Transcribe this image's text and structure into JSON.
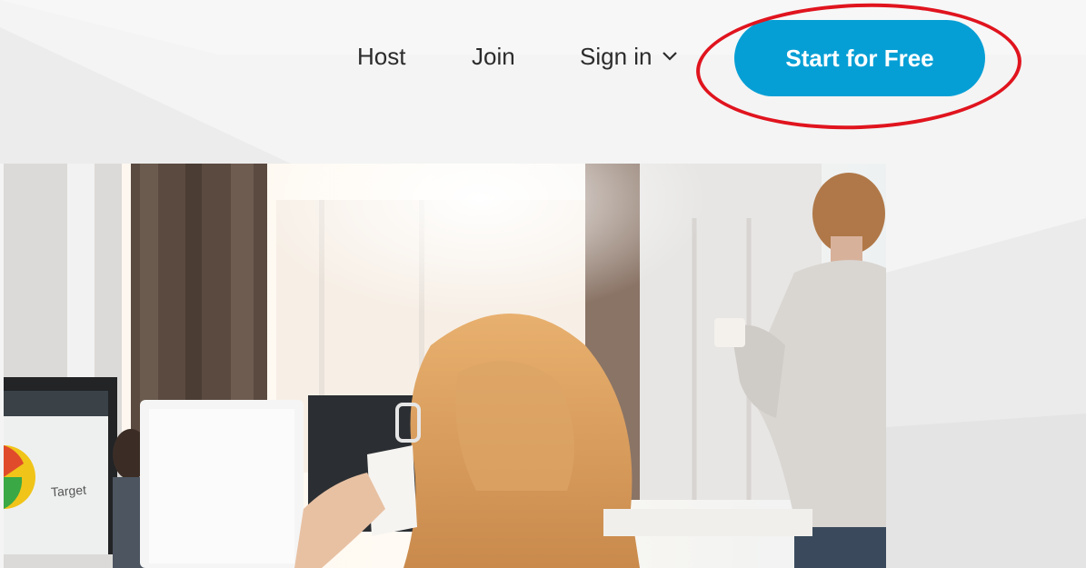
{
  "nav": {
    "host_label": "Host",
    "join_label": "Join",
    "signin_label": "Sign in",
    "cta_label": "Start for Free"
  },
  "monitor": {
    "label": "Target"
  },
  "colors": {
    "cta_bg": "#069fd5",
    "annotation": "#e0141e",
    "background": "#f3f3f3"
  }
}
